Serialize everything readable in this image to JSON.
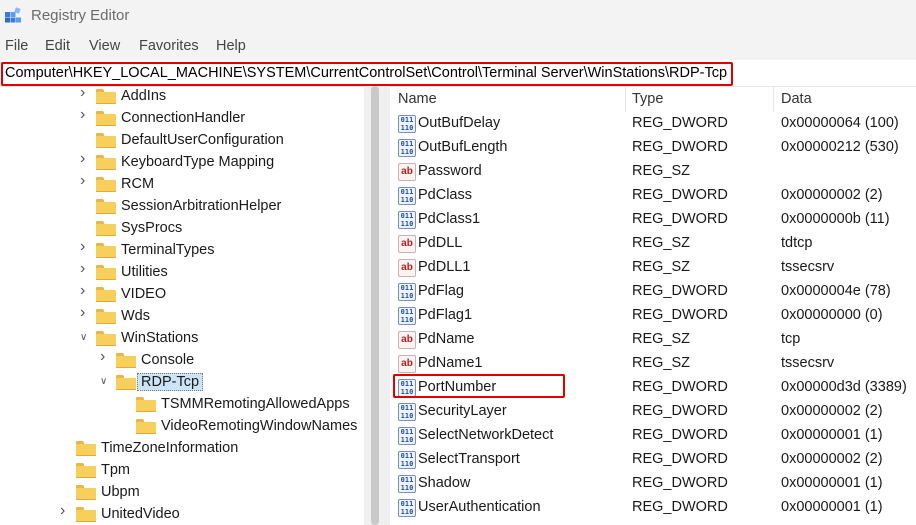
{
  "window": {
    "title": "Registry Editor"
  },
  "menu": [
    "File",
    "Edit",
    "View",
    "Favorites",
    "Help"
  ],
  "address": {
    "path": "Computer\\HKEY_LOCAL_MACHINE\\SYSTEM\\CurrentControlSet\\Control\\Terminal Server\\WinStations\\RDP-Tcp"
  },
  "tree": {
    "items": [
      {
        "label": "AddIns",
        "state": "collapsed"
      },
      {
        "label": "ConnectionHandler",
        "state": "collapsed"
      },
      {
        "label": "DefaultUserConfiguration",
        "state": "none"
      },
      {
        "label": "KeyboardType Mapping",
        "state": "collapsed"
      },
      {
        "label": "RCM",
        "state": "collapsed"
      },
      {
        "label": "SessionArbitrationHelper",
        "state": "none"
      },
      {
        "label": "SysProcs",
        "state": "none"
      },
      {
        "label": "TerminalTypes",
        "state": "collapsed"
      },
      {
        "label": "Utilities",
        "state": "collapsed"
      },
      {
        "label": "VIDEO",
        "state": "collapsed"
      },
      {
        "label": "Wds",
        "state": "collapsed"
      },
      {
        "label": "WinStations",
        "state": "expanded"
      },
      {
        "label": "Console",
        "state": "collapsed"
      },
      {
        "label": "RDP-Tcp",
        "state": "expanded",
        "selected": true
      },
      {
        "label": "TSMMRemotingAllowedApps",
        "state": "none"
      },
      {
        "label": "VideoRemotingWindowNames",
        "state": "none"
      },
      {
        "label": "TimeZoneInformation",
        "state": "none"
      },
      {
        "label": "Tpm",
        "state": "none"
      },
      {
        "label": "Ubpm",
        "state": "none"
      },
      {
        "label": "UnitedVideo",
        "state": "collapsed"
      }
    ]
  },
  "list": {
    "headers": {
      "name": "Name",
      "type": "Type",
      "data": "Data"
    },
    "rows": [
      {
        "name": "OutBufDelay",
        "type": "REG_DWORD",
        "data": "0x00000064 (100)",
        "kind": "bin"
      },
      {
        "name": "OutBufLength",
        "type": "REG_DWORD",
        "data": "0x00000212 (530)",
        "kind": "bin"
      },
      {
        "name": "Password",
        "type": "REG_SZ",
        "data": "",
        "kind": "sz"
      },
      {
        "name": "PdClass",
        "type": "REG_DWORD",
        "data": "0x00000002 (2)",
        "kind": "bin"
      },
      {
        "name": "PdClass1",
        "type": "REG_DWORD",
        "data": "0x0000000b (11)",
        "kind": "bin"
      },
      {
        "name": "PdDLL",
        "type": "REG_SZ",
        "data": "tdtcp",
        "kind": "sz"
      },
      {
        "name": "PdDLL1",
        "type": "REG_SZ",
        "data": "tssecsrv",
        "kind": "sz"
      },
      {
        "name": "PdFlag",
        "type": "REG_DWORD",
        "data": "0x0000004e (78)",
        "kind": "bin"
      },
      {
        "name": "PdFlag1",
        "type": "REG_DWORD",
        "data": "0x00000000 (0)",
        "kind": "bin"
      },
      {
        "name": "PdName",
        "type": "REG_SZ",
        "data": "tcp",
        "kind": "sz"
      },
      {
        "name": "PdName1",
        "type": "REG_SZ",
        "data": "tssecsrv",
        "kind": "sz"
      },
      {
        "name": "PortNumber",
        "type": "REG_DWORD",
        "data": "0x00000d3d (3389)",
        "kind": "bin",
        "highlighted": true
      },
      {
        "name": "SecurityLayer",
        "type": "REG_DWORD",
        "data": "0x00000002 (2)",
        "kind": "bin"
      },
      {
        "name": "SelectNetworkDetect",
        "type": "REG_DWORD",
        "data": "0x00000001 (1)",
        "kind": "bin"
      },
      {
        "name": "SelectTransport",
        "type": "REG_DWORD",
        "data": "0x00000002 (2)",
        "kind": "bin"
      },
      {
        "name": "Shadow",
        "type": "REG_DWORD",
        "data": "0x00000001 (1)",
        "kind": "bin"
      },
      {
        "name": "UserAuthentication",
        "type": "REG_DWORD",
        "data": "0x00000001 (1)",
        "kind": "bin"
      }
    ]
  },
  "icons": {
    "bin_glyph": "011\n110",
    "sz_glyph": "ab"
  },
  "colors": {
    "highlight": "#e00000",
    "selection": "#cce4f7",
    "folder": "#f7cf5b"
  }
}
